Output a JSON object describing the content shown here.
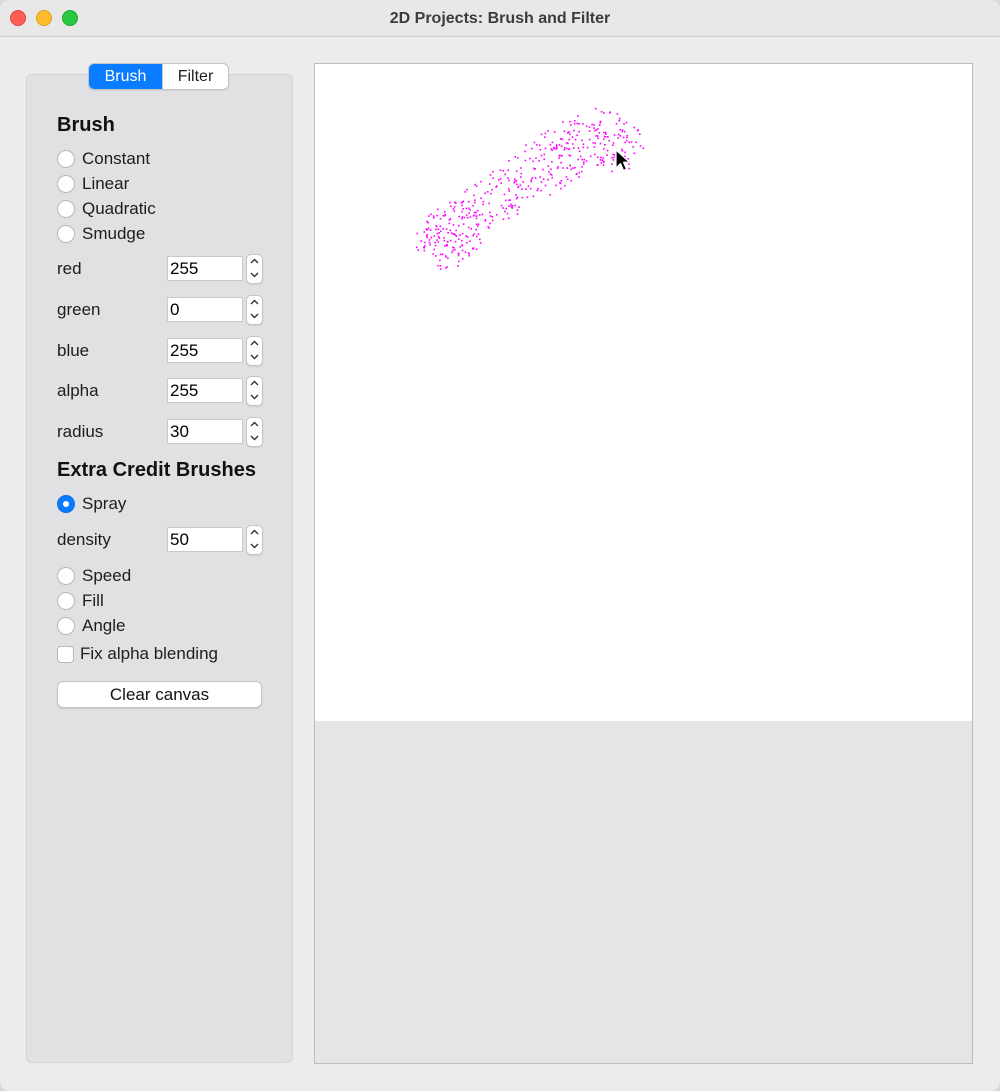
{
  "window": {
    "title": "2D Projects: Brush and Filter"
  },
  "tabs": [
    {
      "label": "Brush",
      "active": true
    },
    {
      "label": "Filter",
      "active": false
    }
  ],
  "brush": {
    "heading": "Brush",
    "options": [
      {
        "label": "Constant",
        "checked": false
      },
      {
        "label": "Linear",
        "checked": false
      },
      {
        "label": "Quadratic",
        "checked": false
      },
      {
        "label": "Smudge",
        "checked": false
      }
    ],
    "fields": [
      {
        "label": "red",
        "value": "255"
      },
      {
        "label": "green",
        "value": "0"
      },
      {
        "label": "blue",
        "value": "255"
      },
      {
        "label": "alpha",
        "value": "255"
      },
      {
        "label": "radius",
        "value": "30"
      }
    ]
  },
  "extra": {
    "heading": "Extra Credit Brushes",
    "spray": {
      "label": "Spray",
      "checked": true
    },
    "density": {
      "label": "density",
      "value": "50"
    },
    "options": [
      {
        "label": "Speed",
        "checked": false
      },
      {
        "label": "Fill",
        "checked": false
      },
      {
        "label": "Angle",
        "checked": false
      }
    ],
    "fix_alpha": {
      "label": "Fix alpha blending",
      "checked": false
    }
  },
  "clear_button": "Clear canvas",
  "colors": {
    "accent": "#0a7cff",
    "paint": "#ff00ff",
    "canvas": "#ffffff"
  },
  "icons": {
    "cursor": "arrow-cursor-icon",
    "stepper_up": "chevron-up-icon",
    "stepper_down": "chevron-down-icon"
  }
}
